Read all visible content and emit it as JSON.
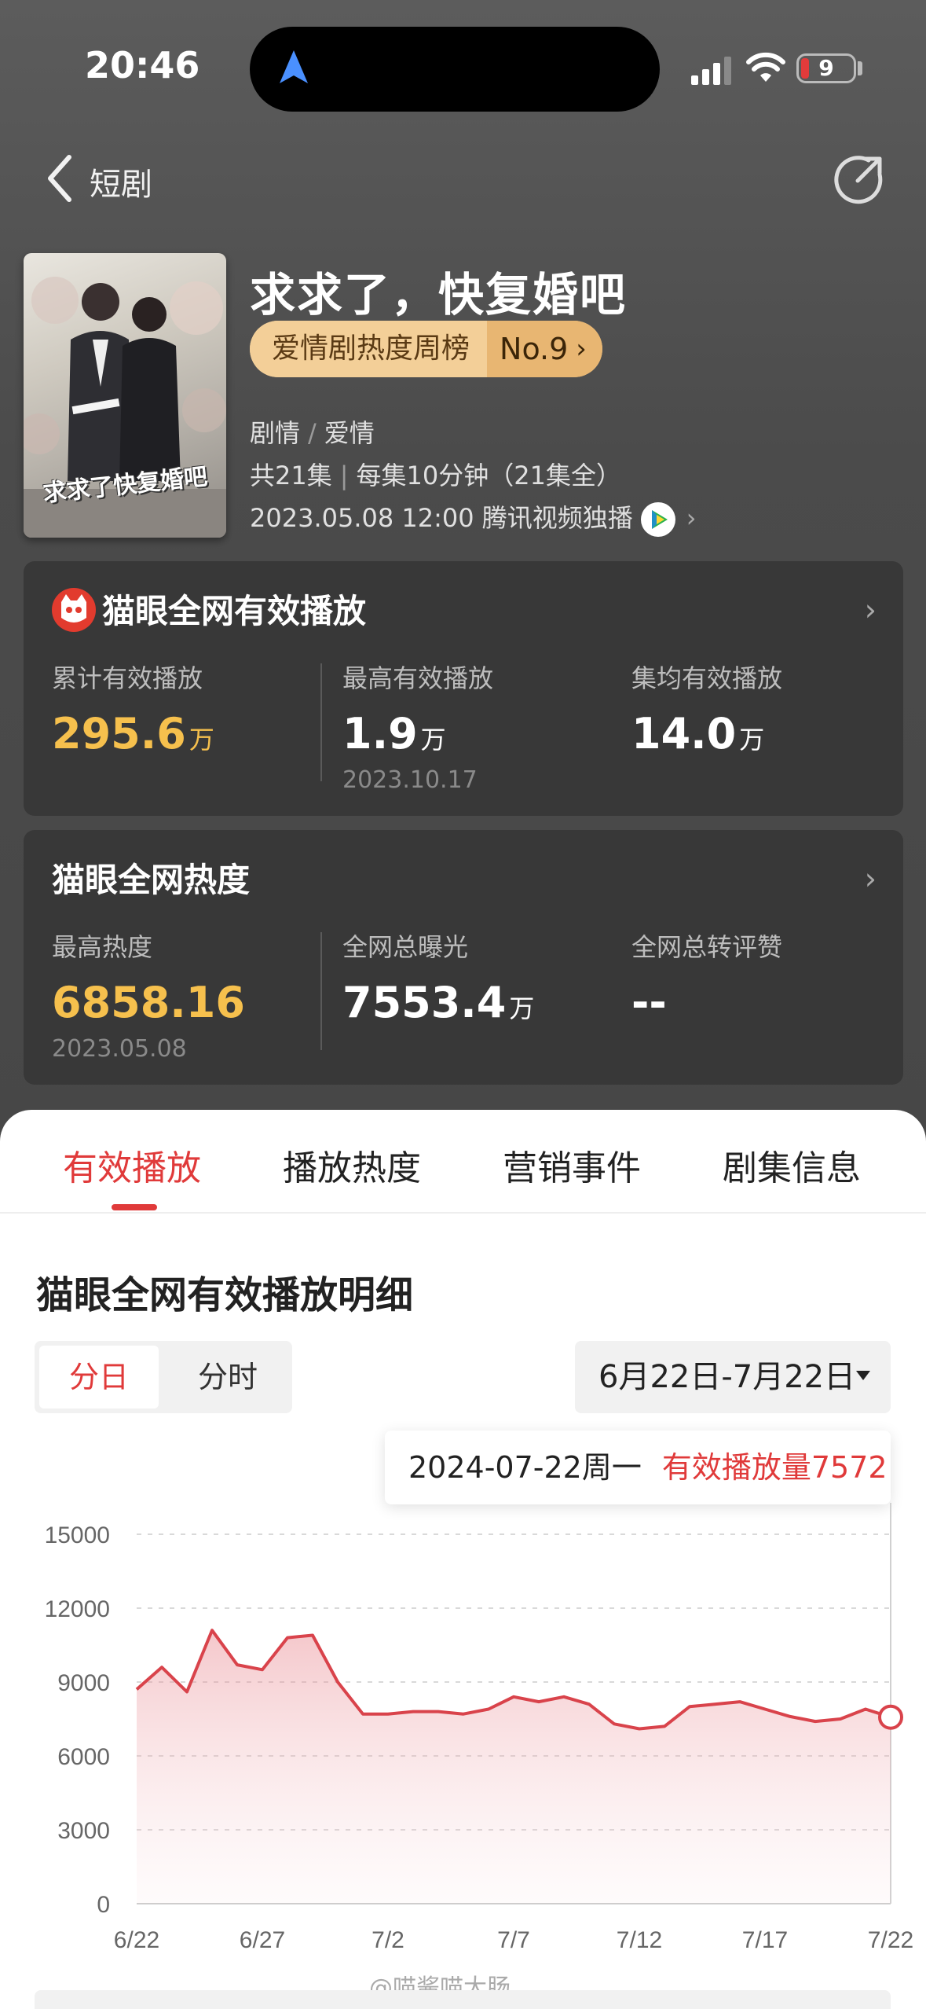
{
  "status": {
    "time": "20:46",
    "battery": "9"
  },
  "header": {
    "back_label": "短剧"
  },
  "drama": {
    "title": "求求了，快复婚吧",
    "poster_title": "求求了快复婚吧",
    "rank_label": "爱情剧热度周榜",
    "rank_no": "No.9",
    "genre1": "剧情",
    "genre2": "爱情",
    "episodes": "共21集",
    "per_episode": "每集10分钟（21集全）",
    "release": "2023.05.08 12:00 腾讯视频独播"
  },
  "card_play": {
    "title": "猫眼全网有效播放",
    "stats": [
      {
        "label": "累计有效播放",
        "value": "295.6",
        "unit": "万",
        "sub": ""
      },
      {
        "label": "最高有效播放",
        "value": "1.9",
        "unit": "万",
        "sub": "2023.10.17"
      },
      {
        "label": "集均有效播放",
        "value": "14.0",
        "unit": "万",
        "sub": ""
      }
    ]
  },
  "card_heat": {
    "title": "猫眼全网热度",
    "stats": [
      {
        "label": "最高热度",
        "value": "6858.16",
        "unit": "",
        "sub": "2023.05.08"
      },
      {
        "label": "全网总曝光",
        "value": "7553.4",
        "unit": "万",
        "sub": ""
      },
      {
        "label": "全网总转评赞",
        "value": "--",
        "unit": "",
        "sub": ""
      }
    ]
  },
  "tabs": [
    "有效播放",
    "播放热度",
    "营销事件",
    "剧集信息"
  ],
  "detail": {
    "title": "猫眼全网有效播放明细",
    "seg_day": "分日",
    "seg_hour": "分时",
    "date_range": "6月22日-7月22日",
    "tooltip_date": "2024-07-22周一",
    "tooltip_value": "有效播放量7572"
  },
  "watermark": "@喵酱喵大肠",
  "colors": {
    "accent": "#e03a3a",
    "gold": "#f6c04d",
    "line": "#d9434b"
  },
  "chart_data": {
    "type": "area",
    "ylim": [
      0,
      15000
    ],
    "yticks": [
      0,
      3000,
      6000,
      9000,
      12000,
      15000
    ],
    "xticks": [
      "6/22",
      "6/27",
      "7/2",
      "7/7",
      "7/12",
      "7/17",
      "7/22"
    ],
    "x": [
      "6/22",
      "6/23",
      "6/24",
      "6/25",
      "6/26",
      "6/27",
      "6/28",
      "6/29",
      "6/30",
      "7/1",
      "7/2",
      "7/3",
      "7/4",
      "7/5",
      "7/6",
      "7/7",
      "7/8",
      "7/9",
      "7/10",
      "7/11",
      "7/12",
      "7/13",
      "7/14",
      "7/15",
      "7/16",
      "7/17",
      "7/18",
      "7/19",
      "7/20",
      "7/21",
      "7/22"
    ],
    "values": [
      8700,
      9600,
      8600,
      11100,
      9700,
      9500,
      10800,
      10900,
      9000,
      7700,
      7700,
      7800,
      7800,
      7700,
      7900,
      8400,
      8200,
      8400,
      8100,
      7300,
      7100,
      7200,
      8000,
      8100,
      8200,
      7900,
      7600,
      7400,
      7500,
      7900,
      7572
    ]
  }
}
